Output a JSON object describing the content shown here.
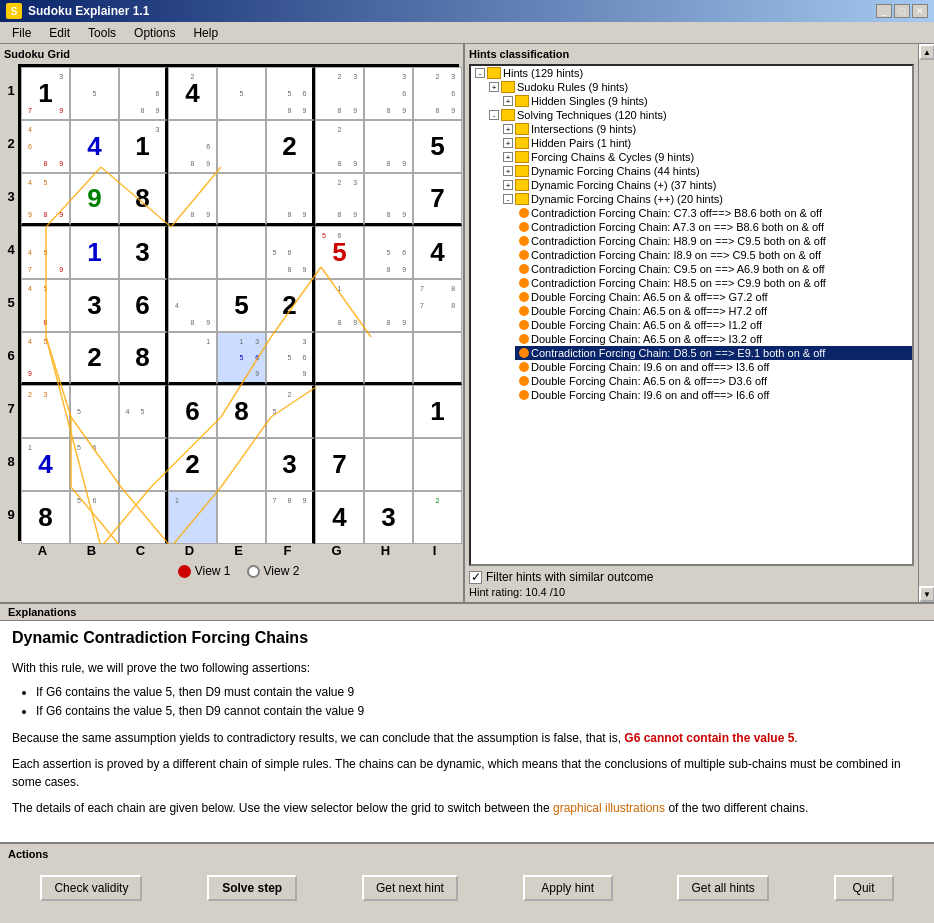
{
  "app": {
    "title": "Sudoku Explainer 1.1",
    "icon": "sudoku-icon"
  },
  "menu": {
    "items": [
      "File",
      "Edit",
      "Tools",
      "Options",
      "Help"
    ]
  },
  "grid_panel": {
    "title": "Sudoku Grid",
    "col_labels": [
      "A",
      "B",
      "C",
      "D",
      "E",
      "F",
      "G",
      "H",
      "I"
    ],
    "row_labels": [
      "1",
      "2",
      "3",
      "4",
      "5",
      "6",
      "7",
      "8",
      "9"
    ],
    "view1_label": "View 1",
    "view2_label": "View 2"
  },
  "hints_panel": {
    "title": "Hints classification",
    "tree": [
      {
        "level": 0,
        "expanded": true,
        "label": "Hints (129 hints)",
        "type": "folder"
      },
      {
        "level": 1,
        "expanded": true,
        "label": "Sudoku Rules (9 hints)",
        "type": "folder"
      },
      {
        "level": 2,
        "expanded": false,
        "label": "Hidden Singles (9 hints)",
        "type": "folder"
      },
      {
        "level": 1,
        "expanded": true,
        "label": "Solving Techniques (120 hints)",
        "type": "folder"
      },
      {
        "level": 2,
        "expanded": false,
        "label": "Intersections (9 hints)",
        "type": "folder"
      },
      {
        "level": 2,
        "expanded": false,
        "label": "Hidden Pairs (1 hint)",
        "type": "folder"
      },
      {
        "level": 2,
        "expanded": false,
        "label": "Forcing Chains & Cycles (9 hints)",
        "type": "folder"
      },
      {
        "level": 2,
        "expanded": false,
        "label": "Dynamic Forcing Chains (44 hints)",
        "type": "folder"
      },
      {
        "level": 2,
        "expanded": false,
        "label": "Dynamic Forcing Chains (+) (37 hints)",
        "type": "folder"
      },
      {
        "level": 2,
        "expanded": true,
        "label": "Dynamic Forcing Chains (++) (20 hints)",
        "type": "folder"
      },
      {
        "level": 3,
        "label": "Contradiction Forcing Chain: C7.3 off==> B8.6 both on & off",
        "type": "hint"
      },
      {
        "level": 3,
        "label": "Contradiction Forcing Chain: A7.3 on ==> B8.6 both on & off",
        "type": "hint"
      },
      {
        "level": 3,
        "label": "Contradiction Forcing Chain: H8.9 on ==> C9.5 both on & off",
        "type": "hint"
      },
      {
        "level": 3,
        "label": "Contradiction Forcing Chain: I8.9 on ==> C9.5 both on & off",
        "type": "hint"
      },
      {
        "level": 3,
        "label": "Contradiction Forcing Chain: C9.5 on ==> A6.9 both on & off",
        "type": "hint"
      },
      {
        "level": 3,
        "label": "Contradiction Forcing Chain: H8.5 on ==> C9.9 both on & off",
        "type": "hint"
      },
      {
        "level": 3,
        "label": "Double Forcing Chain: A6.5 on & off==> G7.2 off",
        "type": "hint"
      },
      {
        "level": 3,
        "label": "Double Forcing Chain: A6.5 on & off==> H7.2 off",
        "type": "hint"
      },
      {
        "level": 3,
        "label": "Double Forcing Chain: A6.5 on & off==> I1.2 off",
        "type": "hint"
      },
      {
        "level": 3,
        "label": "Double Forcing Chain: A6.5 on & off==> I3.2 off",
        "type": "hint"
      },
      {
        "level": 3,
        "label": "Contradiction Forcing Chain: D8.5 on ==> E9.1 both on & off",
        "type": "hint",
        "selected": true
      },
      {
        "level": 3,
        "label": "Double Forcing Chain: I9.6 on and off==> I3.6 off",
        "type": "hint"
      },
      {
        "level": 3,
        "label": "Double Forcing Chain: A6.5 on & off==> D3.6 off",
        "type": "hint"
      },
      {
        "level": 3,
        "label": "Double Forcing Chain: I9.6 on and off==> I6.6 off",
        "type": "hint"
      }
    ],
    "filter_label": "Filter hints with similar outcome",
    "filter_checked": true,
    "hint_rating_label": "Hint rating:",
    "hint_rating_value": "10.4  /10"
  },
  "explanations": {
    "title": "Explanations",
    "heading": "Dynamic Contradiction Forcing Chains",
    "paragraphs": [
      "With this rule, we will prove the two following assertions:",
      "",
      "Because the same assumption yields to contradictory results, we can conclude that the assumption is false, that is,",
      "G6 cannot contain the value 5.",
      "",
      "Each assertion is proved by a different chain of simple rules. The chains can be dynamic, which means that the conclusions of multiple sub-chains must be combined in some cases.",
      "",
      "The details of each chain are given below. Use the view selector below the grid to switch between the graphical illustrations of the two different chains."
    ],
    "bullet1": "If G6 contains the value 5, then D9 must contain the value 9",
    "bullet2": "If G6 contains the value 5, then D9 cannot contain the value 9",
    "highlight_text": "G6 cannot contain the value 5",
    "link_text": "graphical illustrations"
  },
  "actions": {
    "title": "Actions",
    "buttons": [
      {
        "label": "Check validity",
        "id": "check-validity"
      },
      {
        "label": "Solve step",
        "id": "solve-step",
        "bold": true
      },
      {
        "label": "Get next hint",
        "id": "get-next-hint"
      },
      {
        "label": "Apply hint",
        "id": "apply-hint"
      },
      {
        "label": "Get all hints",
        "id": "get-all-hints"
      },
      {
        "label": "Quit",
        "id": "quit"
      }
    ]
  }
}
